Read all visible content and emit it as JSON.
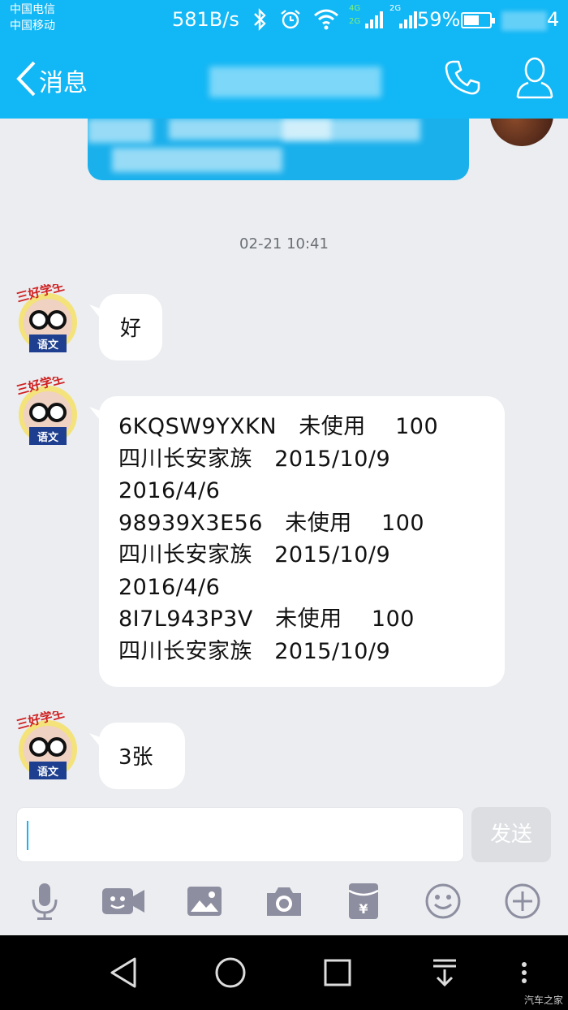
{
  "status_bar": {
    "carrier_1": "中国电信",
    "carrier_2": "中国移动",
    "net_speed": "581B/s",
    "network_1": "4G",
    "network_1b": "2G",
    "network_2": "2G",
    "battery_percent": "59%",
    "battery_level": 0.59,
    "clock_visible_tail": "4"
  },
  "title_bar": {
    "back_label": "消息",
    "icons": [
      "phone-icon",
      "contact-profile-icon"
    ]
  },
  "chat": {
    "timestamp": "02-21 10:41",
    "messages": [
      {
        "sender": "other",
        "lines": [
          "好"
        ]
      },
      {
        "sender": "other",
        "lines": [
          "6KQSW9YXKN   未使用    100",
          "四川长安家族   2015/10/9",
          "2016/4/6",
          "98939X3E56   未使用    100",
          "四川长安家族   2015/10/9",
          "2016/4/6",
          "8I7L943P3V   未使用    100",
          "四川长安家族   2015/10/9"
        ]
      },
      {
        "sender": "other",
        "lines": [
          "3张"
        ]
      }
    ],
    "avatar_badge_top": "三好学生",
    "avatar_badge_bottom": "语文"
  },
  "input": {
    "value": "",
    "send_label": "发送"
  },
  "toolbar": {
    "items": [
      "microphone-icon",
      "video-call-icon",
      "image-icon",
      "camera-icon",
      "red-packet-icon",
      "emoji-icon",
      "plus-icon"
    ]
  },
  "navbar": {
    "items": [
      "back-icon",
      "home-icon",
      "recents-icon",
      "notification-pull-icon",
      "more-icon"
    ]
  },
  "watermark": "汽车之家",
  "colors": {
    "accent": "#12b7f5",
    "background": "#ebedf0",
    "sent_bubble": "#1ab0ec"
  }
}
